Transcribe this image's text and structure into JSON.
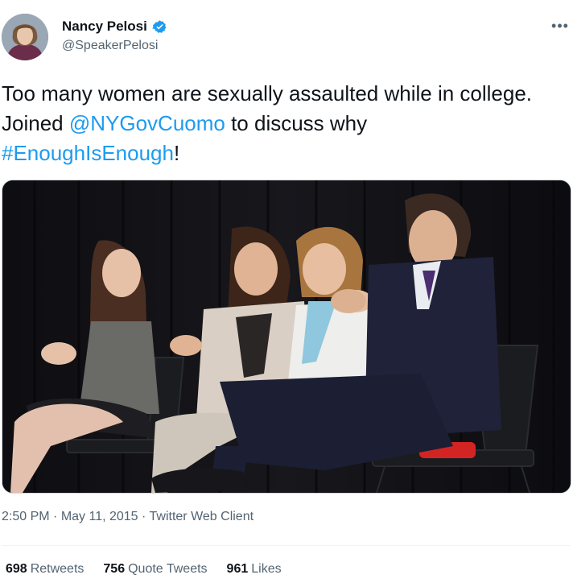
{
  "author": {
    "name": "Nancy Pelosi",
    "handle": "@SpeakerPelosi",
    "verified": true,
    "avatar_icon": "profile-photo"
  },
  "tweet": {
    "text_parts": [
      "Too many women are sexually assaulted while in college. Joined ",
      "@NYGovCuomo",
      " to discuss why ",
      "#EnoughIsEnough",
      "!"
    ],
    "link_color": "#1d9bf0"
  },
  "media": {
    "type": "photo"
  },
  "meta": {
    "time": "2:50 PM",
    "sep1": " · ",
    "date": "May 11, 2015",
    "sep2": " · ",
    "source": "Twitter Web Client"
  },
  "stats": {
    "retweets_count": "698",
    "retweets_label": "Retweets",
    "quotes_count": "756",
    "quotes_label": "Quote Tweets",
    "likes_count": "961",
    "likes_label": "Likes"
  },
  "more_icon": "more-horizontal-icon"
}
